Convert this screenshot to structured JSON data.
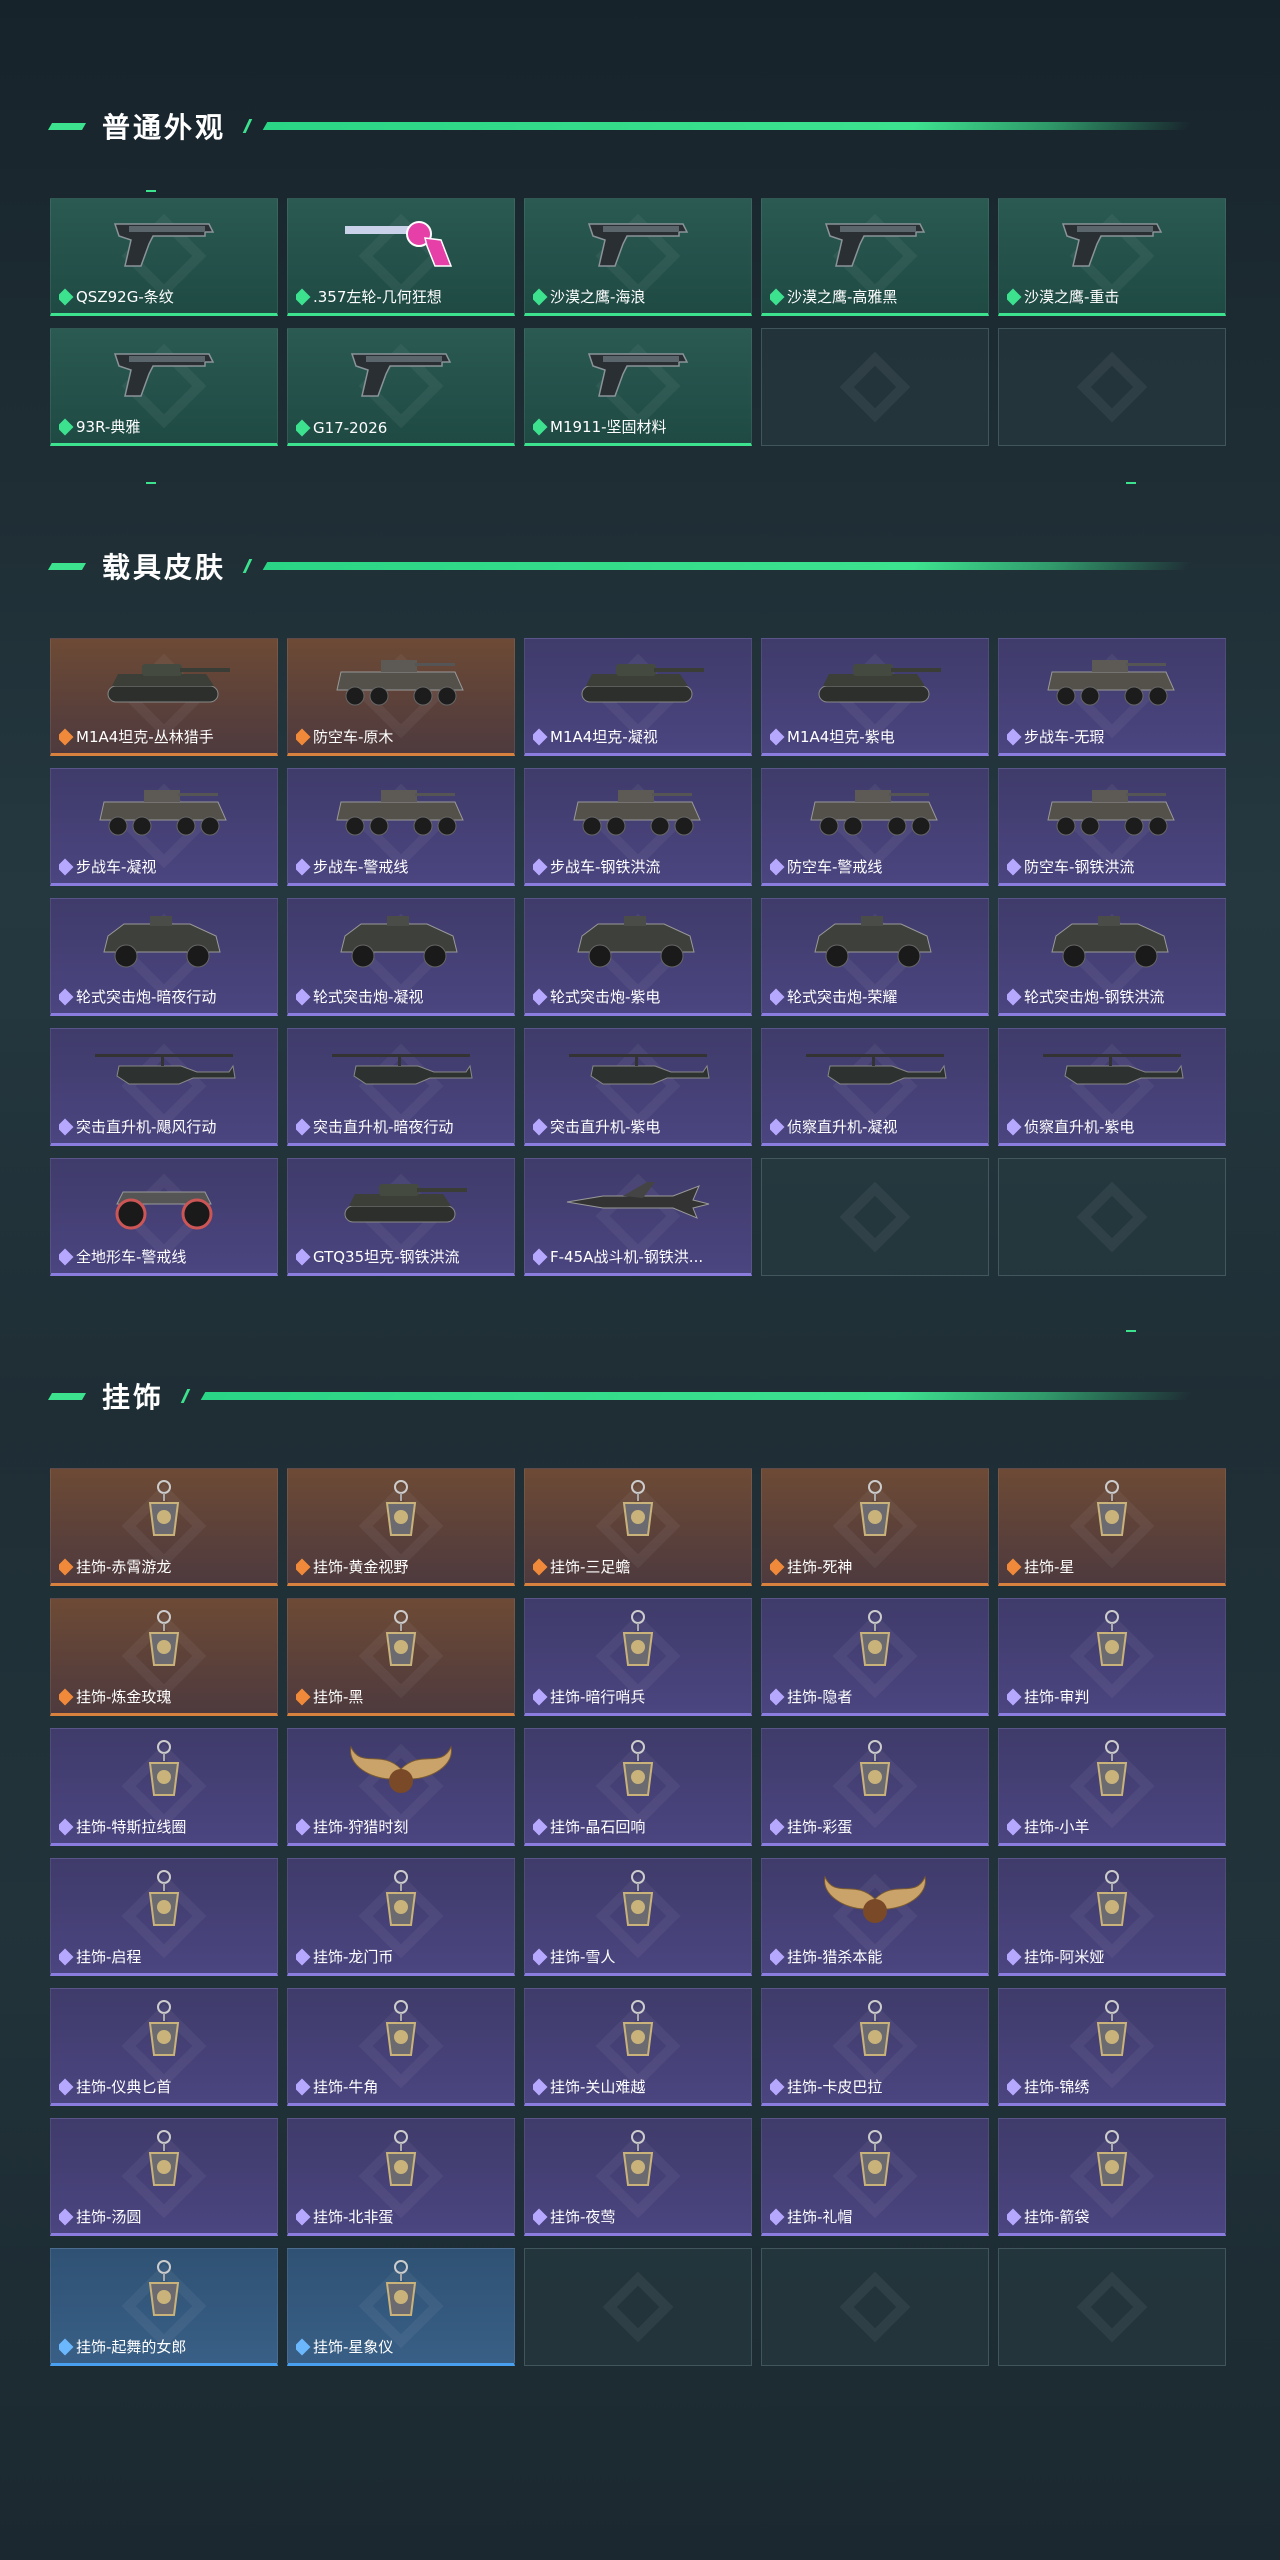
{
  "sections": {
    "weapons": {
      "title": "普通外观",
      "items": [
        {
          "label": "QSZ92G-条纹",
          "rarity": "green",
          "icon": "pistol-icon"
        },
        {
          "label": ".357左轮-几何狂想",
          "rarity": "green",
          "icon": "revolver-icon"
        },
        {
          "label": "沙漠之鹰-海浪",
          "rarity": "green",
          "icon": "pistol-icon"
        },
        {
          "label": "沙漠之鹰-高雅黑",
          "rarity": "green",
          "icon": "pistol-icon"
        },
        {
          "label": "沙漠之鹰-重击",
          "rarity": "green",
          "icon": "pistol-icon"
        },
        {
          "label": "93R-典雅",
          "rarity": "green",
          "icon": "pistol-icon"
        },
        {
          "label": "G17-2026",
          "rarity": "green",
          "icon": "pistol-icon"
        },
        {
          "label": "M1911-坚固材料",
          "rarity": "green",
          "icon": "pistol-icon"
        },
        {
          "label": "",
          "rarity": "empty"
        },
        {
          "label": "",
          "rarity": "empty"
        }
      ]
    },
    "vehicles": {
      "title": "载具皮肤",
      "items": [
        {
          "label": "M1A4坦克-丛林猎手",
          "rarity": "orange",
          "icon": "tank-icon"
        },
        {
          "label": "防空车-原木",
          "rarity": "orange",
          "icon": "apc-icon"
        },
        {
          "label": "M1A4坦克-凝视",
          "rarity": "purple",
          "icon": "tank-icon"
        },
        {
          "label": "M1A4坦克-紫电",
          "rarity": "purple",
          "icon": "tank-icon"
        },
        {
          "label": "步战车-无瑕",
          "rarity": "purple",
          "icon": "apc-icon"
        },
        {
          "label": "步战车-凝视",
          "rarity": "purple",
          "icon": "apc-icon"
        },
        {
          "label": "步战车-警戒线",
          "rarity": "purple",
          "icon": "apc-icon"
        },
        {
          "label": "步战车-钢铁洪流",
          "rarity": "purple",
          "icon": "apc-icon"
        },
        {
          "label": "防空车-警戒线",
          "rarity": "purple",
          "icon": "apc-icon"
        },
        {
          "label": "防空车-钢铁洪流",
          "rarity": "purple",
          "icon": "apc-icon"
        },
        {
          "label": "轮式突击炮-暗夜行动",
          "rarity": "purple",
          "icon": "armored-car-icon"
        },
        {
          "label": "轮式突击炮-凝视",
          "rarity": "purple",
          "icon": "armored-car-icon"
        },
        {
          "label": "轮式突击炮-紫电",
          "rarity": "purple",
          "icon": "armored-car-icon"
        },
        {
          "label": "轮式突击炮-荣耀",
          "rarity": "purple",
          "icon": "armored-car-icon"
        },
        {
          "label": "轮式突击炮-钢铁洪流",
          "rarity": "purple",
          "icon": "armored-car-icon"
        },
        {
          "label": "突击直升机-飓风行动",
          "rarity": "purple",
          "icon": "helicopter-icon"
        },
        {
          "label": "突击直升机-暗夜行动",
          "rarity": "purple",
          "icon": "helicopter-icon"
        },
        {
          "label": "突击直升机-紫电",
          "rarity": "purple",
          "icon": "helicopter-icon"
        },
        {
          "label": "侦察直升机-凝视",
          "rarity": "purple",
          "icon": "helicopter-icon"
        },
        {
          "label": "侦察直升机-紫电",
          "rarity": "purple",
          "icon": "helicopter-icon"
        },
        {
          "label": "全地形车-警戒线",
          "rarity": "purple",
          "icon": "atv-icon"
        },
        {
          "label": "GTQ35坦克-钢铁洪流",
          "rarity": "purple",
          "icon": "tank-icon"
        },
        {
          "label": "F-45A战斗机-钢铁洪...",
          "rarity": "purple",
          "icon": "jet-icon"
        },
        {
          "label": "",
          "rarity": "empty"
        },
        {
          "label": "",
          "rarity": "empty"
        }
      ]
    },
    "charms": {
      "title": "挂饰",
      "items": [
        {
          "label": "挂饰-赤霄游龙",
          "rarity": "orange",
          "icon": "charm-icon"
        },
        {
          "label": "挂饰-黄金视野",
          "rarity": "orange",
          "icon": "charm-icon"
        },
        {
          "label": "挂饰-三足蟾",
          "rarity": "orange",
          "icon": "charm-icon"
        },
        {
          "label": "挂饰-死神",
          "rarity": "orange",
          "icon": "charm-icon"
        },
        {
          "label": "挂饰-星",
          "rarity": "orange",
          "icon": "charm-icon"
        },
        {
          "label": "挂饰-炼金玫瑰",
          "rarity": "orange",
          "icon": "charm-icon"
        },
        {
          "label": "挂饰-黑",
          "rarity": "orange",
          "icon": "charm-icon"
        },
        {
          "label": "挂饰-暗行哨兵",
          "rarity": "purple",
          "icon": "charm-icon"
        },
        {
          "label": "挂饰-隐者",
          "rarity": "purple",
          "icon": "charm-icon"
        },
        {
          "label": "挂饰-审判",
          "rarity": "purple",
          "icon": "charm-icon"
        },
        {
          "label": "挂饰-特斯拉线圈",
          "rarity": "purple",
          "icon": "charm-icon"
        },
        {
          "label": "挂饰-狩猎时刻",
          "rarity": "purple",
          "icon": "antler-icon"
        },
        {
          "label": "挂饰-晶石回响",
          "rarity": "purple",
          "icon": "charm-icon"
        },
        {
          "label": "挂饰-彩蛋",
          "rarity": "purple",
          "icon": "charm-icon"
        },
        {
          "label": "挂饰-小羊",
          "rarity": "purple",
          "icon": "charm-icon"
        },
        {
          "label": "挂饰-启程",
          "rarity": "purple",
          "icon": "charm-icon"
        },
        {
          "label": "挂饰-龙门币",
          "rarity": "purple",
          "icon": "charm-icon"
        },
        {
          "label": "挂饰-雪人",
          "rarity": "purple",
          "icon": "charm-icon"
        },
        {
          "label": "挂饰-猎杀本能",
          "rarity": "purple",
          "icon": "antler-icon"
        },
        {
          "label": "挂饰-阿米娅",
          "rarity": "purple",
          "icon": "charm-icon"
        },
        {
          "label": "挂饰-仪典匕首",
          "rarity": "purple",
          "icon": "charm-icon"
        },
        {
          "label": "挂饰-牛角",
          "rarity": "purple",
          "icon": "charm-icon"
        },
        {
          "label": "挂饰-关山难越",
          "rarity": "purple",
          "icon": "charm-icon"
        },
        {
          "label": "挂饰-卡皮巴拉",
          "rarity": "purple",
          "icon": "charm-icon"
        },
        {
          "label": "挂饰-锦绣",
          "rarity": "purple",
          "icon": "charm-icon"
        },
        {
          "label": "挂饰-汤圆",
          "rarity": "purple",
          "icon": "charm-icon"
        },
        {
          "label": "挂饰-北非蛋",
          "rarity": "purple",
          "icon": "charm-icon"
        },
        {
          "label": "挂饰-夜莺",
          "rarity": "purple",
          "icon": "charm-icon"
        },
        {
          "label": "挂饰-礼帽",
          "rarity": "purple",
          "icon": "charm-icon"
        },
        {
          "label": "挂饰-箭袋",
          "rarity": "purple",
          "icon": "charm-icon"
        },
        {
          "label": "挂饰-起舞的女郎",
          "rarity": "blue",
          "icon": "charm-icon"
        },
        {
          "label": "挂饰-星象仪",
          "rarity": "blue",
          "icon": "charm-icon"
        },
        {
          "label": "",
          "rarity": "empty"
        },
        {
          "label": "",
          "rarity": "empty"
        },
        {
          "label": "",
          "rarity": "empty"
        }
      ]
    }
  },
  "colors": {
    "accent": "#3de28f",
    "green": "#3de28f",
    "purple": "#8b7ce0",
    "orange": "#d8803e",
    "blue": "#4aa0f0"
  }
}
